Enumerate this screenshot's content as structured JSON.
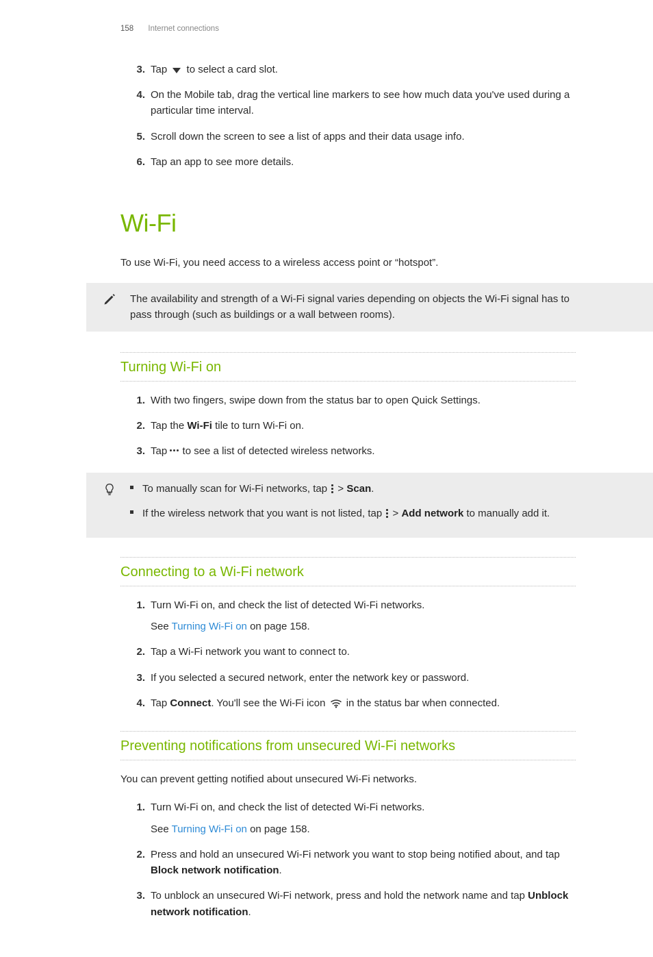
{
  "header": {
    "page_number": "158",
    "section": "Internet connections"
  },
  "top_steps": {
    "s3_pre": "Tap ",
    "s3_post": " to select a card slot.",
    "s4": "On the Mobile tab, drag the vertical line markers to see how much data you've used during a particular time interval.",
    "s5": "Scroll down the screen to see a list of apps and their data usage info.",
    "s6": "Tap an app to see more details.",
    "n3": "3.",
    "n4": "4.",
    "n5": "5.",
    "n6": "6."
  },
  "wifi": {
    "title": "Wi-Fi",
    "intro": "To use Wi-Fi, you need access to a wireless access point or “hotspot”.",
    "note": "The availability and strength of a Wi-Fi signal varies depending on objects the Wi-Fi signal has to pass through (such as buildings or a wall between rooms)."
  },
  "turn_on": {
    "heading": "Turning Wi-Fi on",
    "n1": "1.",
    "n2": "2.",
    "n3": "3.",
    "s1": "With two fingers, swipe down from the status bar to open Quick Settings.",
    "s2_pre": "Tap the ",
    "s2_bold": "Wi-Fi",
    "s2_post": " tile to turn Wi-Fi on.",
    "s3_pre": "Tap ",
    "s3_post": " to see a list of detected wireless networks."
  },
  "tips": {
    "t1_pre": "To manually scan for Wi-Fi networks, tap ",
    "t1_mid": " > ",
    "t1_bold": "Scan",
    "t1_post": ".",
    "t2_pre": "If the wireless network that you want is not listed, tap ",
    "t2_mid": " > ",
    "t2_bold": "Add network",
    "t2_post": " to manually add it."
  },
  "connect": {
    "heading": "Connecting to a Wi-Fi network",
    "n1": "1.",
    "n2": "2.",
    "n3": "3.",
    "n4": "4.",
    "s1": "Turn Wi-Fi on, and check the list of detected Wi-Fi networks.",
    "s1b_pre": "See ",
    "s1b_link": "Turning Wi-Fi on",
    "s1b_post": " on page 158.",
    "s2": "Tap a Wi-Fi network you want to connect to.",
    "s3": "If you selected a secured network, enter the network key or password.",
    "s4_pre": "Tap ",
    "s4_bold": "Connect",
    "s4_mid": ". You'll see the Wi-Fi icon ",
    "s4_post": " in the status bar when connected."
  },
  "prevent": {
    "heading": "Preventing notifications from unsecured Wi-Fi networks",
    "intro": "You can prevent getting notified about unsecured Wi-Fi networks.",
    "n1": "1.",
    "n2": "2.",
    "n3": "3.",
    "s1": "Turn Wi-Fi on, and check the list of detected Wi-Fi networks.",
    "s1b_pre": "See ",
    "s1b_link": "Turning Wi-Fi on",
    "s1b_post": " on page 158.",
    "s2_pre": "Press and hold an unsecured Wi-Fi network you want to stop being notified about, and tap ",
    "s2_bold": "Block network notification",
    "s2_post": ".",
    "s3_pre": "To unblock an unsecured Wi-Fi network, press and hold the network name and tap ",
    "s3_bold": "Unblock network notification",
    "s3_post": "."
  }
}
